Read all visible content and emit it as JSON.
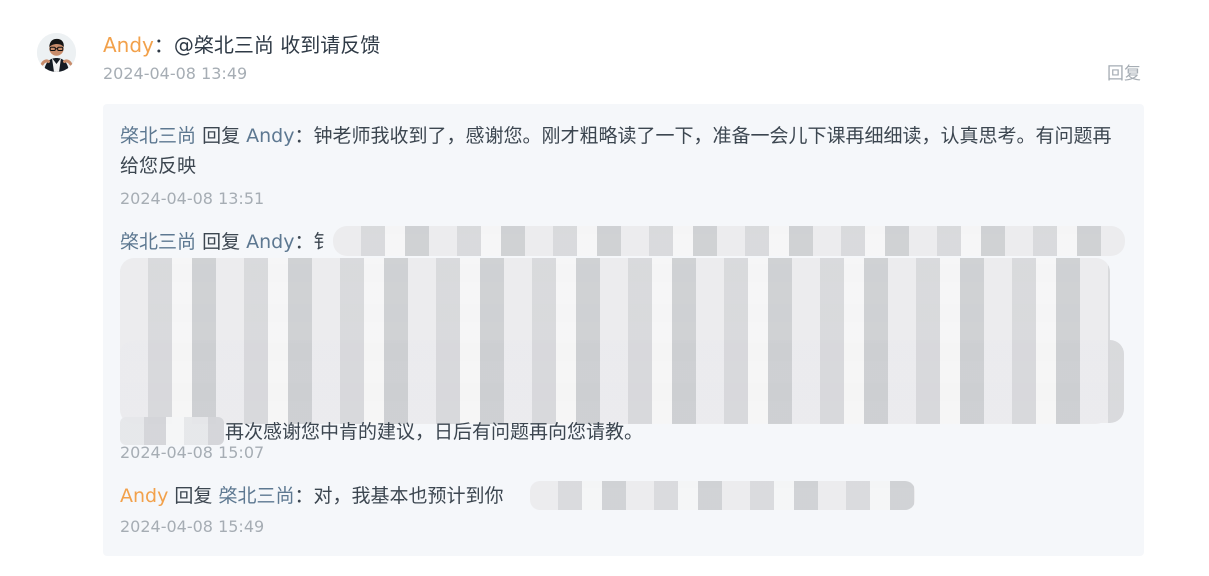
{
  "main_comment": {
    "author": "Andy",
    "separator": "：",
    "text": "@棨北三尚 收到请反馈",
    "time": "2024-04-08 13:49",
    "reply_label": "回复"
  },
  "replies": [
    {
      "author": "棨北三尚",
      "reply_word": "回复",
      "target": "Andy",
      "separator": "：",
      "text": "钟老师我收到了，感谢您。刚才粗略读了一下，准备一会儿下课再细细读，认真思考。有问题再给您反映",
      "time": "2024-04-08 13:51"
    },
    {
      "author": "棨北三尚",
      "reply_word": "回复",
      "target": "Andy",
      "separator": "：",
      "prefix": "钅",
      "visible_end": "再次感谢您中肯的建议，日后有问题再向您请教。",
      "time": "2024-04-08 15:07"
    },
    {
      "author": "Andy",
      "reply_word": "回复",
      "target": "棨北三尚",
      "separator": "：",
      "text": "对，我基本也预计到你",
      "time": "2024-04-08 15:49"
    }
  ],
  "colors": {
    "author_orange": "#f2a14b",
    "author_blue": "#5d7891",
    "meta_gray": "#a6adb4",
    "reply_bg": "#f5f7fa"
  },
  "icons": {
    "avatar": "user-avatar-photo"
  }
}
